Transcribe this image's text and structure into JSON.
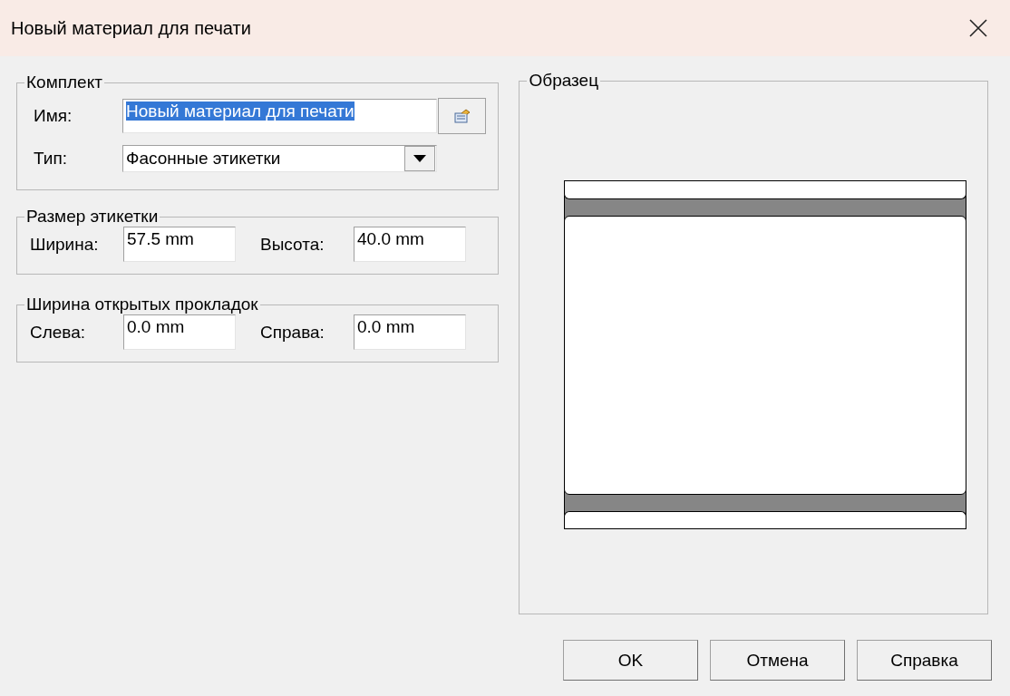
{
  "window": {
    "title": "Новый материал для печати"
  },
  "set_group": {
    "title": "Комплект",
    "name_label": "Имя:",
    "name_value": "Новый материал для печати",
    "name_selected": true,
    "type_label": "Тип:",
    "type_value": "Фасонные этикетки"
  },
  "size_group": {
    "title": "Размер этикетки",
    "fields": [
      {
        "label": "Ширина:",
        "value": "57.5 mm"
      },
      {
        "label": "Высота:",
        "value": "40.0 mm"
      }
    ]
  },
  "gap_group": {
    "title": "Ширина открытых прокладок",
    "fields": [
      {
        "label": "Слева:",
        "value": "0.0 mm"
      },
      {
        "label": "Справа:",
        "value": "0.0 mm"
      }
    ]
  },
  "preview": {
    "title": "Образец"
  },
  "buttons": [
    "OK",
    "Отмена",
    "Справка"
  ]
}
